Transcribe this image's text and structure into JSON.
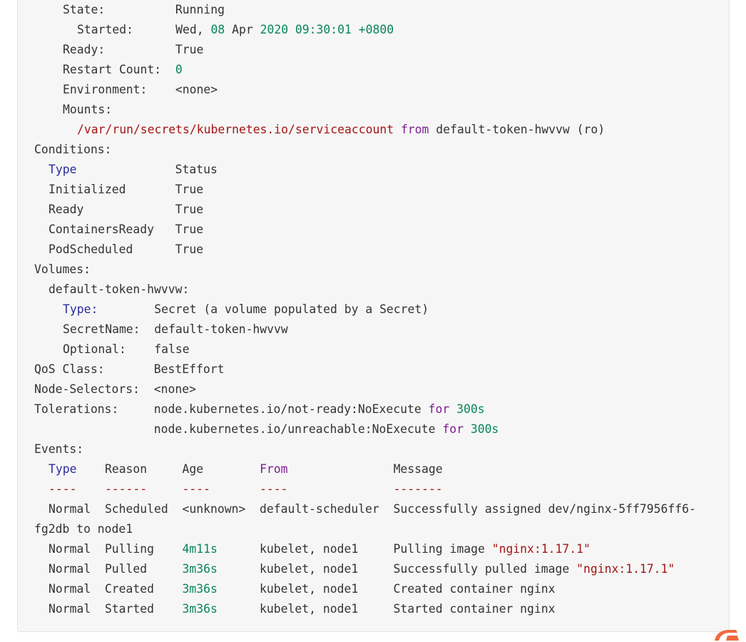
{
  "lines": [
    {
      "indent": 40,
      "parts": [
        {
          "t": "State:          Running",
          "c": ""
        }
      ]
    },
    {
      "indent": 60,
      "parts": [
        {
          "t": "Started:      Wed, ",
          "c": ""
        },
        {
          "t": "08",
          "c": "num"
        },
        {
          "t": " Apr ",
          "c": ""
        },
        {
          "t": "2020 09:30:01 +0800",
          "c": "num"
        }
      ]
    },
    {
      "indent": 40,
      "parts": [
        {
          "t": "Ready:          True",
          "c": ""
        }
      ]
    },
    {
      "indent": 40,
      "parts": [
        {
          "t": "Restart Count:  ",
          "c": ""
        },
        {
          "t": "0",
          "c": "num"
        }
      ]
    },
    {
      "indent": 40,
      "parts": [
        {
          "t": "Environment:    <none>",
          "c": ""
        }
      ]
    },
    {
      "indent": 40,
      "parts": [
        {
          "t": "Mounts:",
          "c": ""
        }
      ]
    },
    {
      "indent": 60,
      "parts": [
        {
          "t": "/var/run/secrets/kubernetes.io/serviceaccount",
          "c": "pth"
        },
        {
          "t": " ",
          "c": ""
        },
        {
          "t": "from",
          "c": "fr"
        },
        {
          "t": " default-token-hwvvw (ro)",
          "c": ""
        }
      ]
    },
    {
      "indent": 0,
      "parts": [
        {
          "t": "Conditions:",
          "c": ""
        }
      ]
    },
    {
      "indent": 20,
      "parts": [
        {
          "t": "Type",
          "c": "kw"
        },
        {
          "t": "              Status",
          "c": ""
        }
      ]
    },
    {
      "indent": 20,
      "parts": [
        {
          "t": "Initialized       True",
          "c": ""
        }
      ]
    },
    {
      "indent": 20,
      "parts": [
        {
          "t": "Ready             True",
          "c": ""
        }
      ]
    },
    {
      "indent": 20,
      "parts": [
        {
          "t": "ContainersReady   True",
          "c": ""
        }
      ]
    },
    {
      "indent": 20,
      "parts": [
        {
          "t": "PodScheduled      True",
          "c": ""
        }
      ]
    },
    {
      "indent": 0,
      "parts": [
        {
          "t": "Volumes:",
          "c": ""
        }
      ]
    },
    {
      "indent": 20,
      "parts": [
        {
          "t": "default-token-hwvvw:",
          "c": ""
        }
      ]
    },
    {
      "indent": 40,
      "parts": [
        {
          "t": "Type:",
          "c": "kw"
        },
        {
          "t": "        Secret (a volume populated by a Secret)",
          "c": ""
        }
      ]
    },
    {
      "indent": 40,
      "parts": [
        {
          "t": "SecretName:  default-token-hwvvw",
          "c": ""
        }
      ]
    },
    {
      "indent": 40,
      "parts": [
        {
          "t": "Optional:    false",
          "c": ""
        }
      ]
    },
    {
      "indent": 0,
      "parts": [
        {
          "t": "QoS Class:       BestEffort",
          "c": ""
        }
      ]
    },
    {
      "indent": 0,
      "parts": [
        {
          "t": "Node-Selectors:  <none>",
          "c": ""
        }
      ]
    },
    {
      "indent": 0,
      "parts": [
        {
          "t": "Tolerations:     node.kubernetes.io/not-ready:NoExecute ",
          "c": ""
        },
        {
          "t": "for",
          "c": "fr"
        },
        {
          "t": " ",
          "c": ""
        },
        {
          "t": "300s",
          "c": "num"
        }
      ]
    },
    {
      "indent": 0,
      "parts": [
        {
          "t": "                 node.kubernetes.io/unreachable:NoExecute ",
          "c": ""
        },
        {
          "t": "for",
          "c": "fr"
        },
        {
          "t": " ",
          "c": ""
        },
        {
          "t": "300s",
          "c": "num"
        }
      ]
    },
    {
      "indent": 0,
      "parts": [
        {
          "t": "Events:",
          "c": ""
        }
      ]
    },
    {
      "indent": 20,
      "parts": [
        {
          "t": "Type",
          "c": "kw"
        },
        {
          "t": "    Reason     Age        ",
          "c": ""
        },
        {
          "t": "From",
          "c": "fr"
        },
        {
          "t": "               Message",
          "c": ""
        }
      ]
    },
    {
      "indent": 20,
      "parts": [
        {
          "t": "----    ------     ----       ----               -------",
          "c": "dash"
        }
      ]
    },
    {
      "indent": 20,
      "parts": [
        {
          "t": "Normal  Scheduled  <unknown>  default-scheduler  Successfully assigned dev/nginx-5ff7956ff6-",
          "c": ""
        }
      ]
    },
    {
      "indent": 0,
      "parts": [
        {
          "t": "fg2db to node1",
          "c": ""
        }
      ]
    },
    {
      "indent": 20,
      "parts": [
        {
          "t": "Normal  Pulling    ",
          "c": ""
        },
        {
          "t": "4m11s",
          "c": "num"
        },
        {
          "t": "      kubelet, node1     Pulling image ",
          "c": ""
        },
        {
          "t": "\"nginx:1.17.1\"",
          "c": "str"
        }
      ]
    },
    {
      "indent": 20,
      "parts": [
        {
          "t": "Normal  Pulled     ",
          "c": ""
        },
        {
          "t": "3m36s",
          "c": "num"
        },
        {
          "t": "      kubelet, node1     Successfully pulled image ",
          "c": ""
        },
        {
          "t": "\"nginx:1.17.1\"",
          "c": "str"
        }
      ]
    },
    {
      "indent": 20,
      "parts": [
        {
          "t": "Normal  Created    ",
          "c": ""
        },
        {
          "t": "3m36s",
          "c": "num"
        },
        {
          "t": "      kubelet, node1     Created container nginx",
          "c": ""
        }
      ]
    },
    {
      "indent": 20,
      "parts": [
        {
          "t": "Normal  Started    ",
          "c": ""
        },
        {
          "t": "3m36s",
          "c": "num"
        },
        {
          "t": "      kubelet, node1     Started container nginx",
          "c": ""
        }
      ]
    }
  ],
  "brand_icon": "brand-logo-icon",
  "brand_color": "#f06a3f"
}
